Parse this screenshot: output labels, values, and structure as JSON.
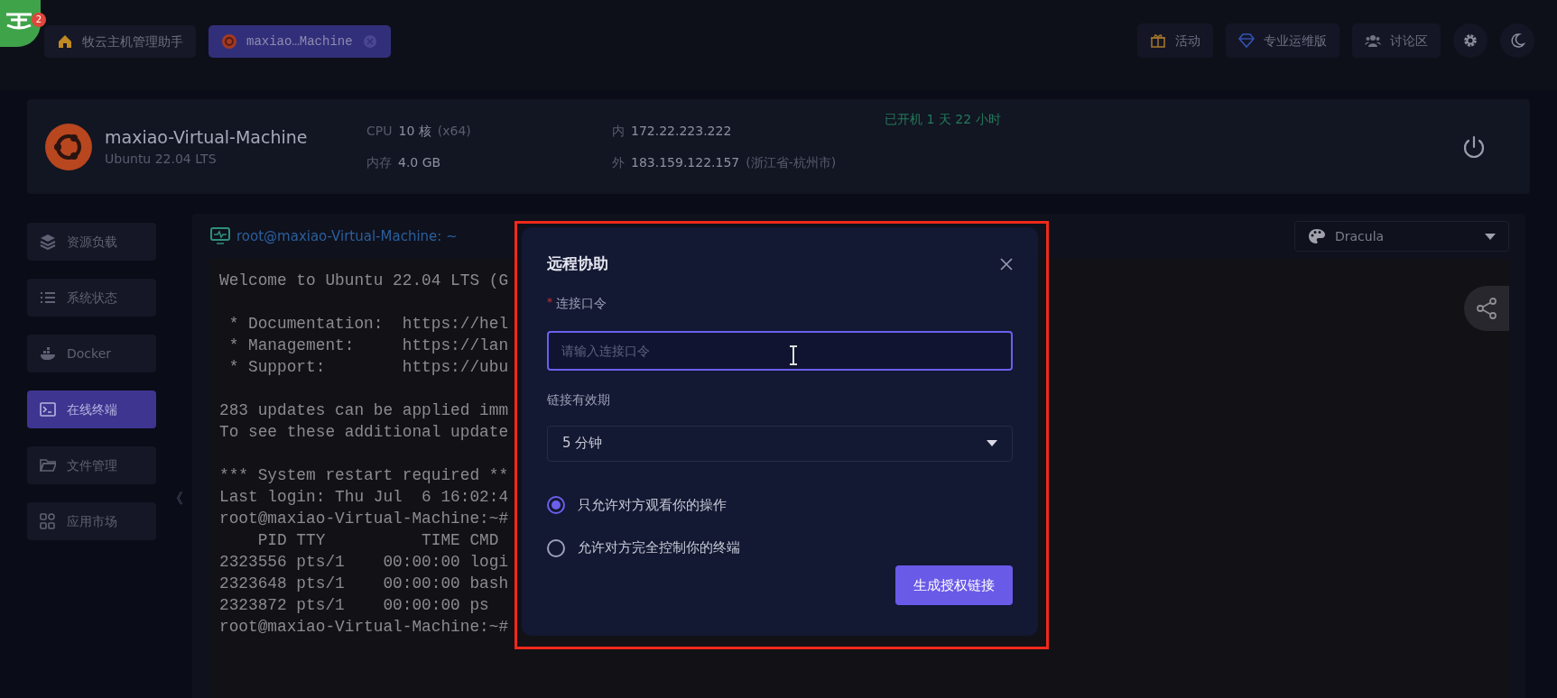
{
  "app": {
    "badge": "2"
  },
  "tabs": [
    {
      "label": "牧云主机管理助手",
      "kind": "home",
      "selected": false
    },
    {
      "label": "maxiao…Machine",
      "kind": "host",
      "selected": true
    }
  ],
  "toolbar": [
    {
      "label": "活动",
      "kind": "gift"
    },
    {
      "label": "专业运维版",
      "kind": "diamond"
    },
    {
      "label": "讨论区",
      "kind": "users"
    },
    {
      "kind": "gear"
    },
    {
      "kind": "moon"
    }
  ],
  "host": {
    "name": "maxiao-Virtual-Machine",
    "os": "Ubuntu 22.04 LTS",
    "cpu_label": "CPU",
    "cpu": "10 核",
    "cpu_arch": "(x64)",
    "mem_label": "内存",
    "mem": "4.0 GB",
    "lan_label": "内",
    "lan_ip": "172.22.223.222",
    "wan_label": "外",
    "wan_ip": "183.159.122.157",
    "wan_location": "(浙江省-杭州市)",
    "uptime": "已开机 1 天 22 小时"
  },
  "sidebar": {
    "items": [
      {
        "label": "资源负载",
        "kind": "layers",
        "selected": false
      },
      {
        "label": "系统状态",
        "kind": "list",
        "selected": false
      },
      {
        "label": "Docker",
        "kind": "docker",
        "selected": false
      },
      {
        "label": "在线终端",
        "kind": "terminal",
        "selected": true
      },
      {
        "label": "文件管理",
        "kind": "folder",
        "selected": false
      },
      {
        "label": "应用市场",
        "kind": "grid",
        "selected": false
      }
    ],
    "collapse": "《"
  },
  "terminal": {
    "title": "root@maxiao-Virtual-Machine: ~",
    "theme": "Dracula",
    "blocks": [
      [
        "Welcome to Ubuntu 22.04 LTS (G"
      ],
      [
        " * Documentation:  https://hel",
        " * Management:     https://lan",
        " * Support:        https://ubu"
      ],
      [
        "283 updates can be applied imm",
        "To see these additional update"
      ],
      [
        "*** System restart required **",
        "Last login: Thu Jul  6 16:02:4",
        "root@maxiao-Virtual-Machine:~#",
        "    PID TTY          TIME CMD",
        "2323556 pts/1    00:00:00 logi",
        "2323648 pts/1    00:00:00 bash",
        "2323872 pts/1    00:00:00 ps",
        "root@maxiao-Virtual-Machine:~#"
      ]
    ]
  },
  "dialog": {
    "title": "远程协助",
    "required_mark": "*",
    "password_label": "连接口令",
    "password_placeholder": "请输入连接口令",
    "expiry_label": "链接有效期",
    "expiry_value": "5 分钟",
    "options": [
      {
        "label": "只允许对方观看你的操作",
        "selected": true
      },
      {
        "label": "允许对方完全控制你的终端",
        "selected": false
      }
    ],
    "submit": "生成授权链接"
  }
}
